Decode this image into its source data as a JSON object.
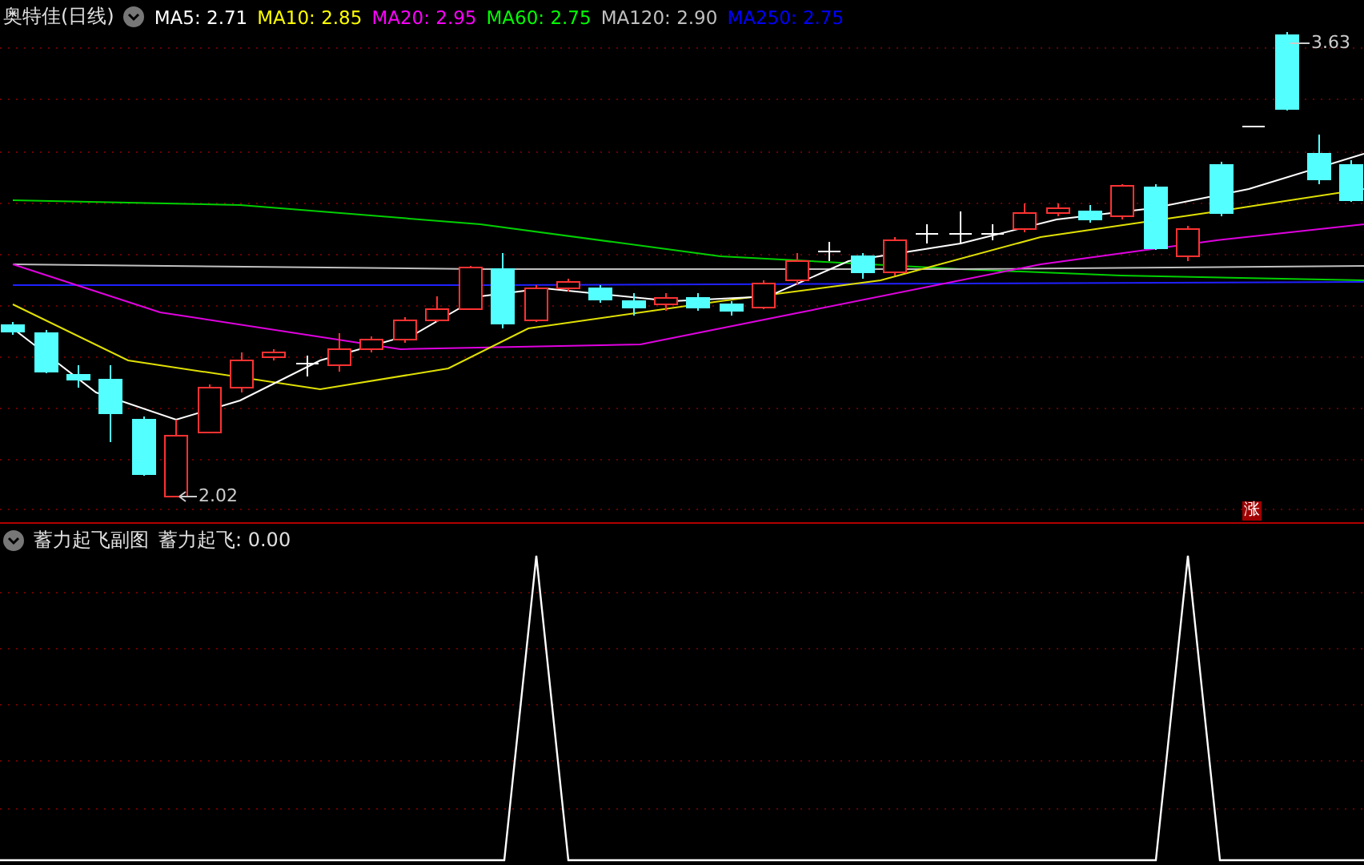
{
  "main_chart": {
    "title": "奥特佳(日线)",
    "indicators": [
      {
        "text": "MA5: 2.71",
        "color": "#ffffff"
      },
      {
        "text": "MA10: 2.85",
        "color": "#ffff00"
      },
      {
        "text": "MA20: 2.95",
        "color": "#ff00ff"
      },
      {
        "text": "MA60: 2.75",
        "color": "#00ff00"
      },
      {
        "text": "MA120: 2.90",
        "color": "#c0c0c0"
      },
      {
        "text": "MA250: 2.75",
        "color": "#0000ff"
      }
    ],
    "high_label": "3.63",
    "low_label": "2.02",
    "badge": "涨"
  },
  "sub_chart": {
    "title": "蓄力起飞副图",
    "reading": "蓄力起飞: 0.00"
  }
}
